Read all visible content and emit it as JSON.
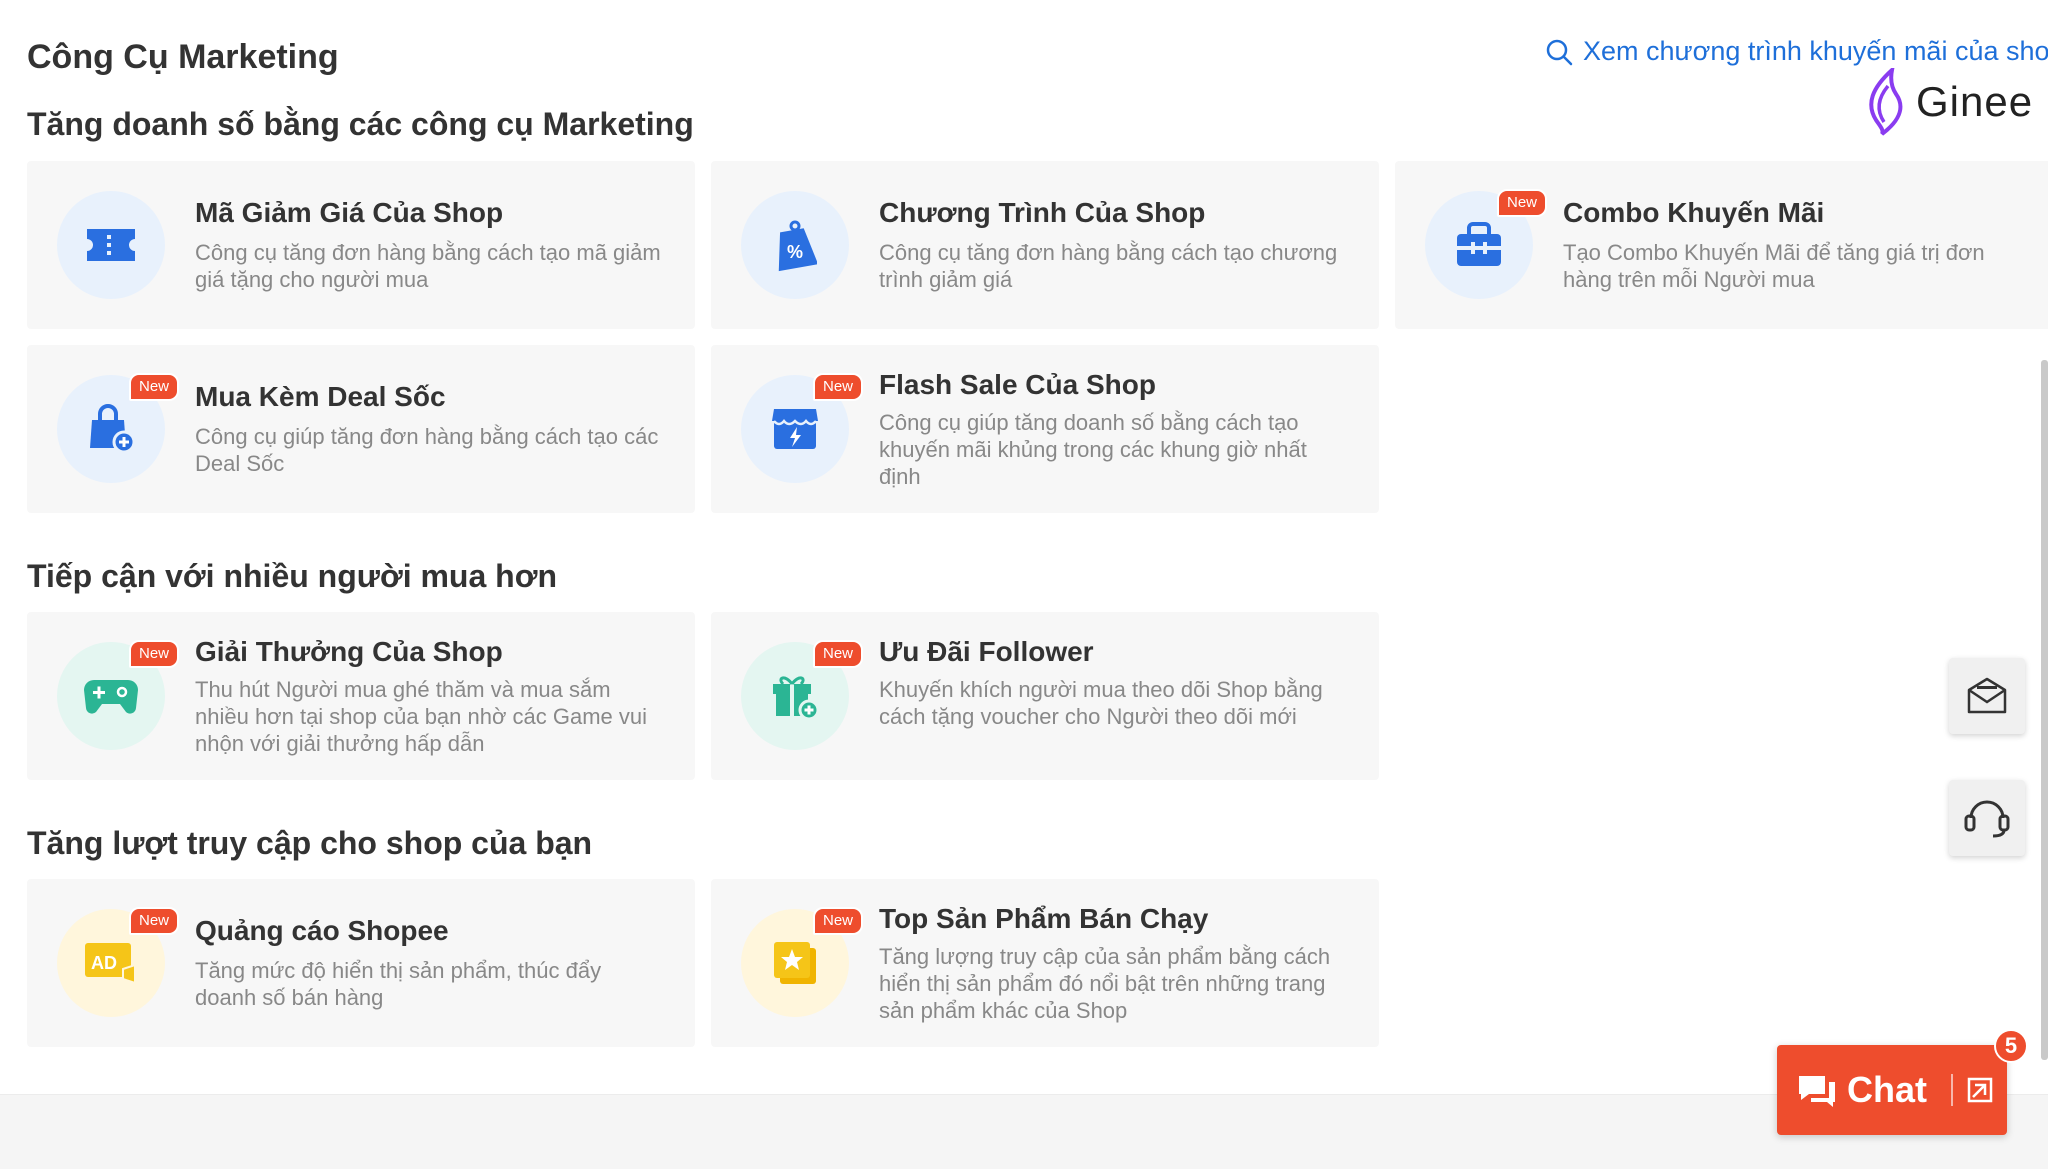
{
  "header": {
    "title": "Công Cụ Marketing",
    "search_link": "Xem chương trình khuyến mãi của shop"
  },
  "logo": {
    "text": "Ginee"
  },
  "badge_label": "New",
  "sections": [
    {
      "title": "Tăng doanh số bằng các công cụ Marketing",
      "cards": [
        {
          "title": "Mã Giảm Giá Của Shop",
          "desc": "Công cụ tăng đơn hàng bằng cách tạo mã giảm giá tặng cho người mua",
          "icon": "ticket-icon",
          "new": false
        },
        {
          "title": "Chương Trình Của Shop",
          "desc": "Công cụ tăng đơn hàng bằng cách tạo chương trình giảm giá",
          "icon": "discount-tag-icon",
          "new": false
        },
        {
          "title": "Combo Khuyến Mãi",
          "desc": "Tạo Combo Khuyến Mãi để tăng giá trị đơn hàng trên mỗi Người mua",
          "icon": "gift-bag-icon",
          "new": true
        },
        {
          "title": "Mua Kèm Deal Sốc",
          "desc": "Công cụ giúp tăng đơn hàng bằng cách tạo các Deal Sốc",
          "icon": "shopping-bag-plus-icon",
          "new": true
        },
        {
          "title": "Flash Sale Của Shop",
          "desc": "Công cụ giúp tăng doanh số bằng cách tạo khuyến mãi khủng trong các khung giờ nhất định",
          "icon": "flash-store-icon",
          "new": true
        }
      ]
    },
    {
      "title": "Tiếp cận với nhiều người mua hơn",
      "cards": [
        {
          "title": "Giải Thưởng Của Shop",
          "desc": "Thu hút Người mua ghé thăm và mua sắm nhiều hơn tại shop của bạn nhờ các Game vui nhộn với giải thưởng hấp dẫn",
          "icon": "gamepad-icon",
          "new": true
        },
        {
          "title": "Ưu Đãi Follower",
          "desc": "Khuyến khích người mua theo dõi Shop bằng cách tặng voucher cho Người theo dõi mới",
          "icon": "gift-plus-icon",
          "new": true
        }
      ]
    },
    {
      "title": "Tăng lượt truy cập cho shop của bạn",
      "cards": [
        {
          "title": "Quảng cáo Shopee",
          "desc": "Tăng mức độ hiển thị sản phẩm, thúc đẩy doanh số bán hàng",
          "icon": "ad-icon",
          "ad_text": "AD",
          "new": true
        },
        {
          "title": "Top Sản Phẩm Bán Chạy",
          "desc": "Tăng lượng truy cập của sản phẩm bằng cách hiển thị sản phẩm đó nổi bật trên những trang sản phẩm khác của Shop",
          "icon": "star-product-icon",
          "new": true
        }
      ]
    }
  ],
  "chat": {
    "label": "Chat",
    "unread_count": "5"
  },
  "colors": {
    "accent": "#ee4d2d",
    "link": "#1e6fd9",
    "icon_blue": "#2a6fe0",
    "icon_green": "#2bb594",
    "icon_yellow": "#f5c518"
  }
}
